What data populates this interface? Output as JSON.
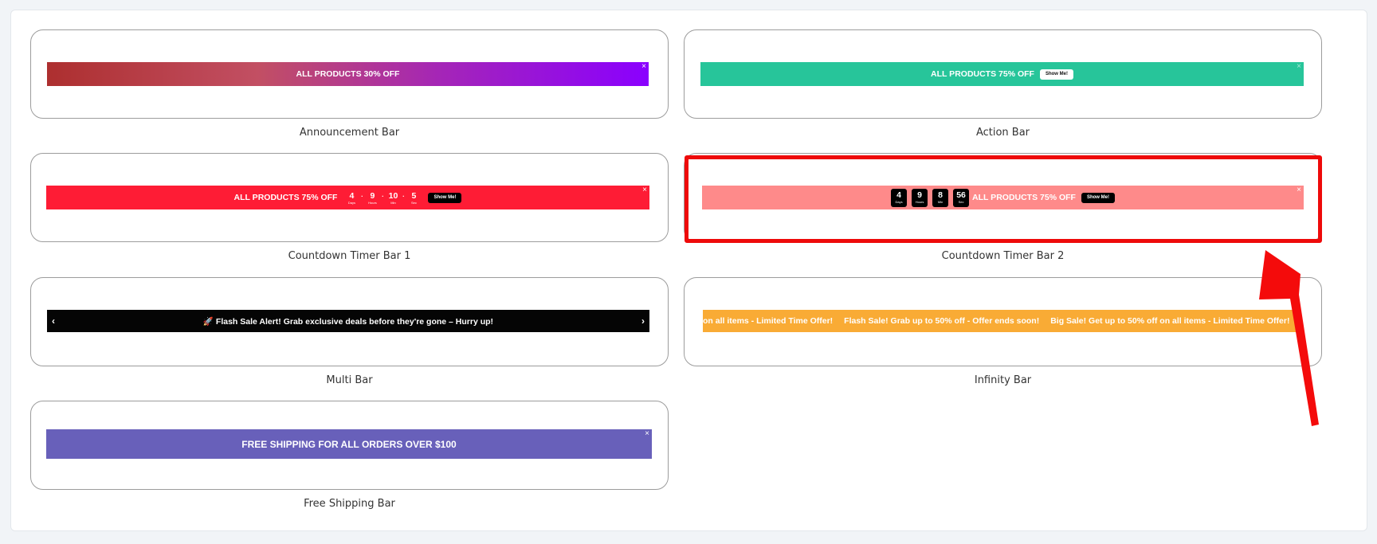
{
  "cards": [
    {
      "label": "Announcement Bar",
      "text": "ALL PRODUCTS 30% OFF",
      "close": "×"
    },
    {
      "label": "Action Bar",
      "text": "ALL PRODUCTS 75% OFF",
      "button": "Show Me!",
      "close": "×"
    },
    {
      "label": "Countdown Timer Bar 1",
      "text": "ALL PRODUCTS 75% OFF",
      "button": "Show Me!",
      "close": "×",
      "timer": [
        {
          "value": "4",
          "unit": "Days"
        },
        {
          "value": "9",
          "unit": "Hours"
        },
        {
          "value": "10",
          "unit": "Min"
        },
        {
          "value": "5",
          "unit": "Sec"
        }
      ]
    },
    {
      "label": "Countdown Timer Bar 2",
      "text": "ALL PRODUCTS 75% OFF",
      "button": "Show Me!",
      "close": "×",
      "timer": [
        {
          "value": "4",
          "unit": "Days"
        },
        {
          "value": "9",
          "unit": "Hours"
        },
        {
          "value": "8",
          "unit": "Min"
        },
        {
          "value": "56",
          "unit": "Sec"
        }
      ]
    },
    {
      "label": "Multi Bar",
      "text": "🚀 Flash Sale Alert! Grab exclusive deals before they're gone – Hurry up!",
      "prev": "‹",
      "next": "›"
    },
    {
      "label": "Infinity Bar",
      "ticker": [
        "on all items - Limited Time Offer!",
        "Flash Sale! Grab up to 50% off - Offer ends soon!",
        "Big Sale! Get up to 50% off on all items - Limited Time Offer!"
      ]
    },
    {
      "label": "Free Shipping Bar",
      "text": "FREE SHIPPING FOR ALL ORDERS OVER $100",
      "close": "×"
    }
  ],
  "colors": {
    "action": "#27c59a",
    "countdown1": "#fe1c35",
    "countdown2": "#fe8a8a",
    "multi": "#050505",
    "infinity": "#f9ab35",
    "shipping": "#6860ba",
    "highlight": "#ee0a0a"
  }
}
